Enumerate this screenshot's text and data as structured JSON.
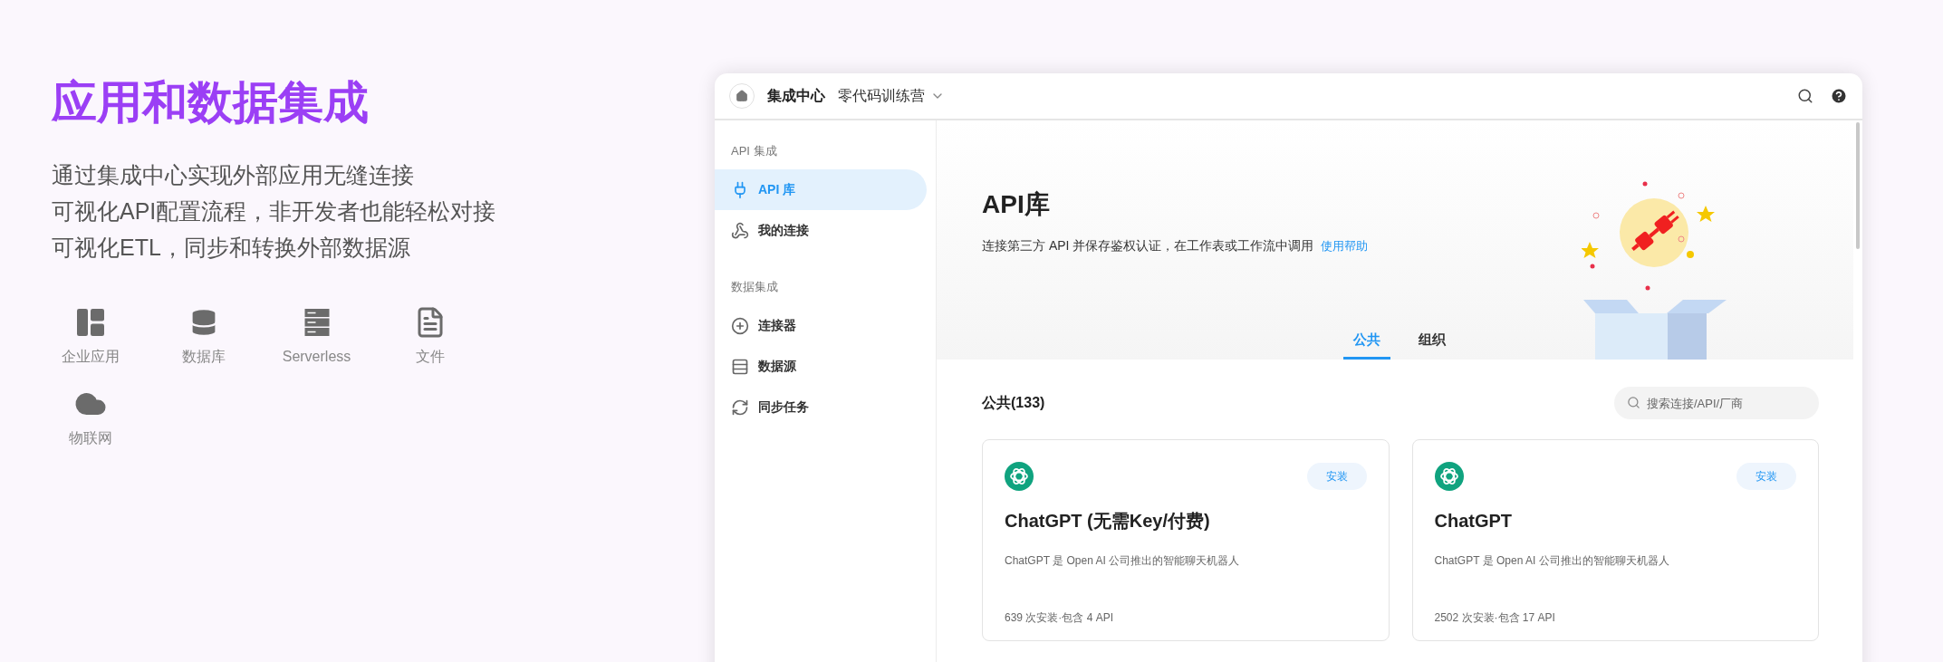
{
  "promo": {
    "title": "应用和数据集成",
    "lines": [
      "通过集成中心实现外部应用无缝连接",
      "可视化API配置流程，非开发者也能轻松对接",
      "可视化ETL，同步和转换外部数据源"
    ],
    "features": [
      {
        "label": "企业应用"
      },
      {
        "label": "数据库"
      },
      {
        "label": "Serverless"
      },
      {
        "label": "文件"
      },
      {
        "label": "物联网"
      }
    ]
  },
  "window": {
    "title": "集成中心",
    "workspace": "零代码训练营"
  },
  "sidebar": {
    "groups": [
      {
        "title": "API 集成",
        "items": [
          {
            "label": "API 库",
            "selected": true
          },
          {
            "label": "我的连接",
            "selected": false
          }
        ]
      },
      {
        "title": "数据集成",
        "items": [
          {
            "label": "连接器",
            "selected": false
          },
          {
            "label": "数据源",
            "selected": false
          },
          {
            "label": "同步任务",
            "selected": false
          }
        ]
      }
    ]
  },
  "hero": {
    "title": "API库",
    "description": "连接第三方 API 并保存鉴权认证，在工作表或工作流中调用",
    "help_link": "使用帮助"
  },
  "tabs": [
    {
      "label": "公共",
      "selected": true
    },
    {
      "label": "组织",
      "selected": false
    }
  ],
  "list": {
    "heading": "公共(133)",
    "search": {
      "placeholder": "搜索连接/API/厂商"
    },
    "cards": [
      {
        "name": "ChatGPT (无需Key/付费)",
        "description": "ChatGPT 是 Open AI 公司推出的智能聊天机器人",
        "stats": "639 次安装·包含 4 API",
        "button": "安装"
      },
      {
        "name": "ChatGPT",
        "description": "ChatGPT 是 Open AI 公司推出的智能聊天机器人",
        "stats": "2502 次安装·包含 17 API",
        "button": "安装"
      }
    ]
  }
}
